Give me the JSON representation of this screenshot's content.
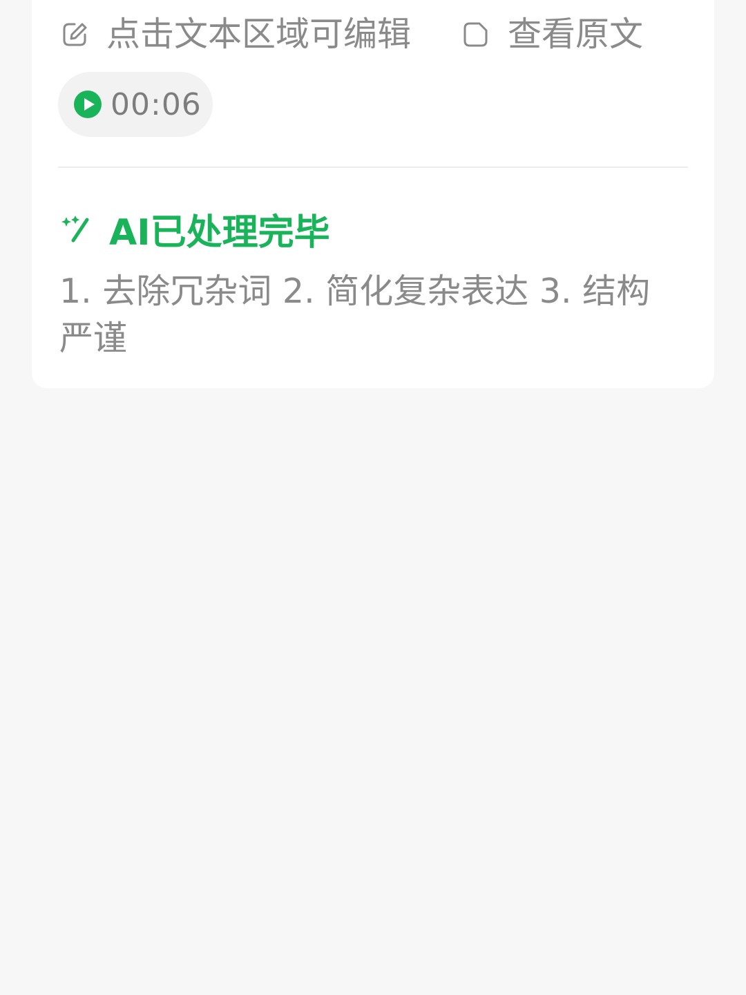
{
  "toolbar": {
    "edit_label": "点击文本区域可编辑",
    "view_original_label": "查看原文"
  },
  "audio": {
    "duration": "00:06"
  },
  "ai": {
    "status": "AI已处理完毕",
    "summary": "1. 去除冗杂词 2. 简化复杂表达 3. 结构严谨"
  },
  "icons": {
    "edit": "edit-pencil-icon",
    "view_original": "document-icon",
    "play": "play-circle-icon",
    "ai": "magic-wand-icon"
  },
  "colors": {
    "accent": "#19b35a",
    "muted_text": "#8a8a8a",
    "page_bg": "#f7f7f7",
    "card_bg": "#ffffff"
  }
}
